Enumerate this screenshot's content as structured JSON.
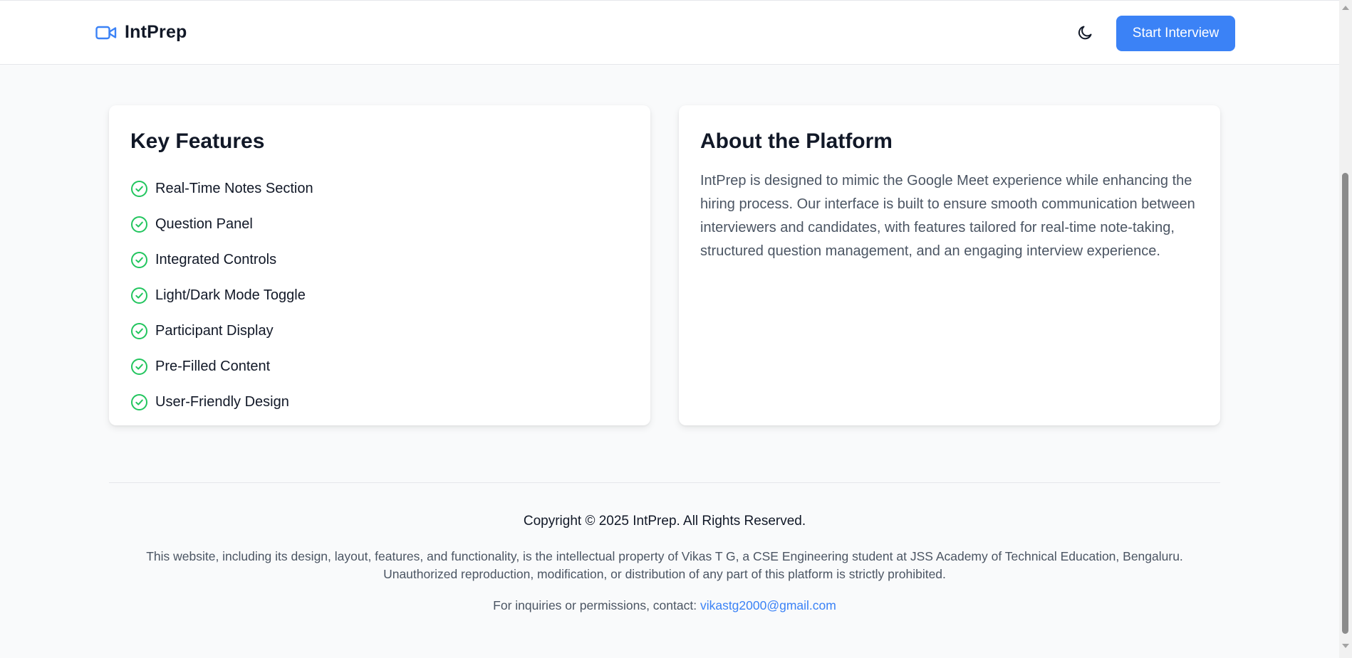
{
  "header": {
    "brand_name": "IntPrep",
    "brand_icon": "video-camera-icon",
    "theme_toggle_icon": "moon-icon",
    "start_button_label": "Start Interview"
  },
  "features_card": {
    "title": "Key Features",
    "item_icon": "check-circle-icon",
    "items": [
      "Real-Time Notes Section",
      "Question Panel",
      "Integrated Controls",
      "Light/Dark Mode Toggle",
      "Participant Display",
      "Pre-Filled Content",
      "User-Friendly Design"
    ]
  },
  "about_card": {
    "title": "About the Platform",
    "text": "IntPrep is designed to mimic the Google Meet experience while enhancing the hiring process. Our interface is built to ensure smooth communication between interviewers and candidates, with features tailored for real-time note-taking, structured question management, and an engaging interview experience."
  },
  "footer": {
    "copyright": "Copyright © 2025 IntPrep. All Rights Reserved.",
    "legal": "This website, including its design, layout, features, and functionality, is the intellectual property of Vikas T G, a CSE Engineering student at JSS Academy of Technical Education, Bengaluru. Unauthorized reproduction, modification, or distribution of any part of this platform is strictly prohibited.",
    "contact_prefix": "For inquiries or permissions, contact: ",
    "contact_email": "vikastg2000@gmail.com"
  },
  "colors": {
    "accent": "#3b82f6",
    "check": "#22c55e",
    "background": "#f9fafb",
    "card": "#ffffff"
  }
}
